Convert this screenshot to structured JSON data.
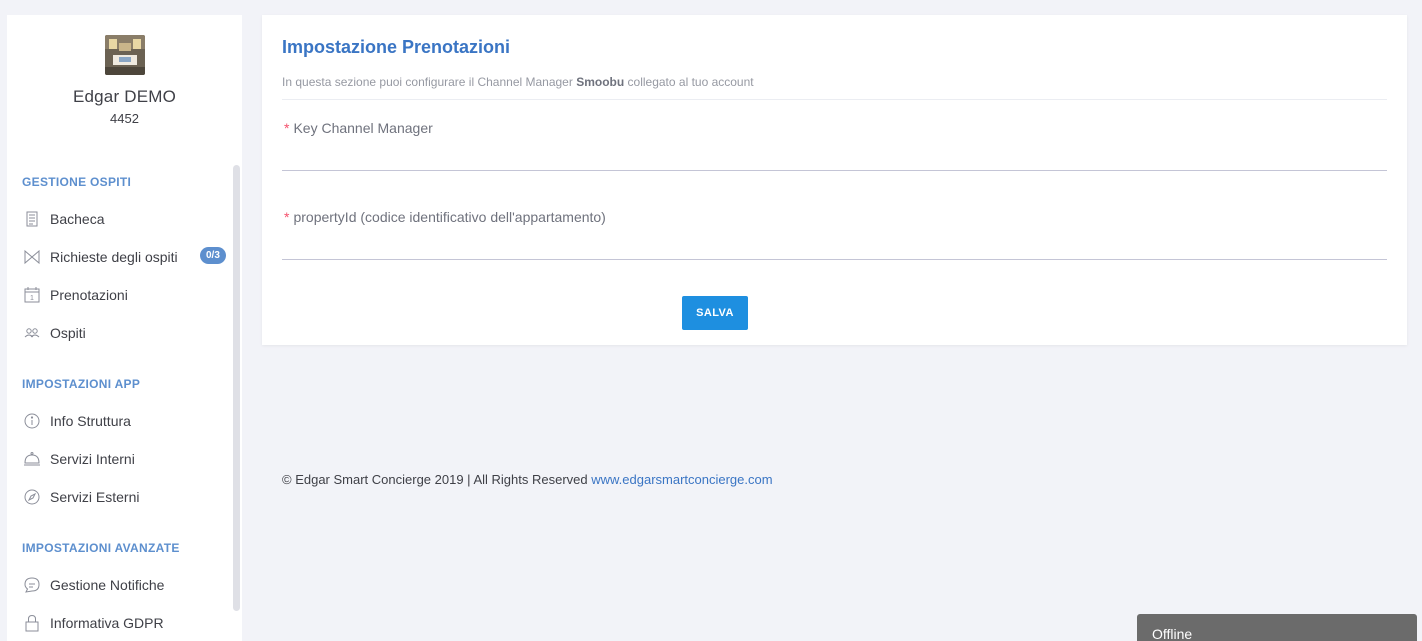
{
  "profile": {
    "name": "Edgar DEMO",
    "id": "4452"
  },
  "sidebar": {
    "sections": [
      {
        "title": "GESTIONE OSPITI"
      },
      {
        "title": "IMPOSTAZIONI APP"
      },
      {
        "title": "IMPOSTAZIONI AVANZATE"
      }
    ],
    "items": [
      {
        "label": "Bacheca",
        "icon": "document-icon"
      },
      {
        "label": "Richieste degli ospiti",
        "icon": "ribbon-icon",
        "badge": "0/3"
      },
      {
        "label": "Prenotazioni",
        "icon": "calendar-icon"
      },
      {
        "label": "Ospiti",
        "icon": "people-icon"
      },
      {
        "label": "Info Struttura",
        "icon": "info-icon"
      },
      {
        "label": "Servizi Interni",
        "icon": "cloche-icon"
      },
      {
        "label": "Servizi Esterni",
        "icon": "compass-icon"
      },
      {
        "label": "Gestione Notifiche",
        "icon": "chat-icon"
      },
      {
        "label": "Informativa GDPR",
        "icon": "lock-icon"
      }
    ]
  },
  "main": {
    "title": "Impostazione Prenotazioni",
    "subtitle_prefix": "In questa sezione puoi configurare il Channel Manager ",
    "subtitle_brand": "Smoobu",
    "subtitle_suffix": " collegato al tuo account",
    "fields": [
      {
        "label": "Key Channel Manager",
        "value": ""
      },
      {
        "label": "propertyId (codice identificativo dell'appartamento)",
        "value": ""
      }
    ],
    "save_label": "SALVA"
  },
  "footer": {
    "text": "© Edgar Smart Concierge 2019 | All Rights Reserved ",
    "link": "www.edgarsmartconcierge.com"
  },
  "chat": {
    "status": "Offline"
  },
  "colors": {
    "accent": "#3a75c4",
    "button": "#1e8fe0",
    "badge": "#5d8fce",
    "required": "#f4516c"
  }
}
